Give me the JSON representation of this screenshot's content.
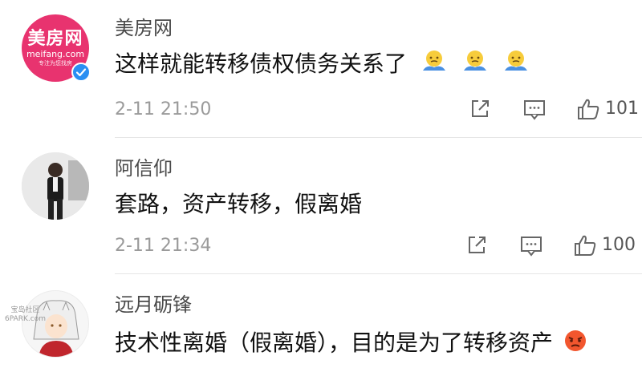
{
  "comments": [
    {
      "avatar": {
        "line1": "美房网",
        "line2": "meifang.com",
        "line3": "专注为您找房"
      },
      "username": "美房网",
      "text": "这样就能转移债权债务关系了",
      "emoji": "shrug-emoji",
      "time": "2-11 21:50",
      "likes": "101",
      "verified": true
    },
    {
      "username": "阿信仰",
      "text": "套路，资产转移，假离婚",
      "time": "2-11 21:34",
      "likes": "100"
    },
    {
      "username": "远月砺锋",
      "text": "技术性离婚（假离婚），目的是为了转移资产",
      "emoji": "angry-emoji"
    }
  ],
  "watermark": {
    "line1": "宝岛社区",
    "line2": "6PARK.com"
  },
  "colors": {
    "brand": "#e8336f",
    "verify": "#2a8ff2",
    "icon": "#666666"
  }
}
